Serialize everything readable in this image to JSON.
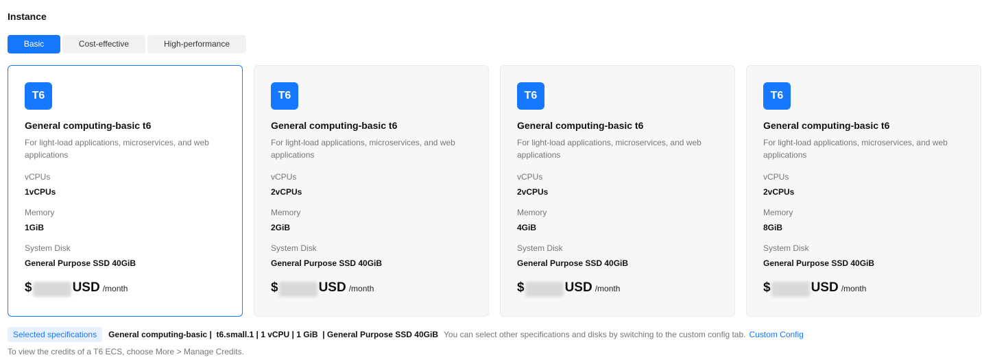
{
  "section": {
    "title": "Instance"
  },
  "tabs": [
    {
      "label": "Basic",
      "active": true
    },
    {
      "label": "Cost-effective",
      "active": false
    },
    {
      "label": "High-performance",
      "active": false
    }
  ],
  "cards": [
    {
      "badge": "T6",
      "name": "General computing-basic t6",
      "description": "For light-load applications, microservices, and web applications",
      "vcpu_label": "vCPUs",
      "vcpu_value": "1vCPUs",
      "memory_label": "Memory",
      "memory_value": "1GiB",
      "disk_label": "System Disk",
      "disk_value": "General Purpose SSD 40GiB",
      "price_symbol": "$",
      "price_unit": "USD",
      "price_period": "/month",
      "selected": true
    },
    {
      "badge": "T6",
      "name": "General computing-basic t6",
      "description": "For light-load applications, microservices, and web applications",
      "vcpu_label": "vCPUs",
      "vcpu_value": "2vCPUs",
      "memory_label": "Memory",
      "memory_value": "2GiB",
      "disk_label": "System Disk",
      "disk_value": "General Purpose SSD 40GiB",
      "price_symbol": "$",
      "price_unit": "USD",
      "price_period": "/month",
      "selected": false
    },
    {
      "badge": "T6",
      "name": "General computing-basic t6",
      "description": "For light-load applications, microservices, and web applications",
      "vcpu_label": "vCPUs",
      "vcpu_value": "2vCPUs",
      "memory_label": "Memory",
      "memory_value": "4GiB",
      "disk_label": "System Disk",
      "disk_value": "General Purpose SSD 40GiB",
      "price_symbol": "$",
      "price_unit": "USD",
      "price_period": "/month",
      "selected": false
    },
    {
      "badge": "T6",
      "name": "General computing-basic t6",
      "description": "For light-load applications, microservices, and web applications",
      "vcpu_label": "vCPUs",
      "vcpu_value": "2vCPUs",
      "memory_label": "Memory",
      "memory_value": "8GiB",
      "disk_label": "System Disk",
      "disk_value": "General Purpose SSD 40GiB",
      "price_symbol": "$",
      "price_unit": "USD",
      "price_period": "/month",
      "selected": false
    }
  ],
  "summary": {
    "tag": "Selected specifications",
    "spec": "General computing-basic |  t6.small.1 | 1 vCPU | 1 GiB  | General Purpose SSD 40GiB",
    "note": "You can select other specifications and disks by switching to the custom config tab.",
    "link": "Custom Config"
  },
  "footnote": "To view the credits of a T6 ECS, choose More > Manage Credits.",
  "colors": {
    "accent": "#1677ff",
    "card_bg": "#f7f7f8",
    "tag_bg": "#e8f1ff"
  }
}
